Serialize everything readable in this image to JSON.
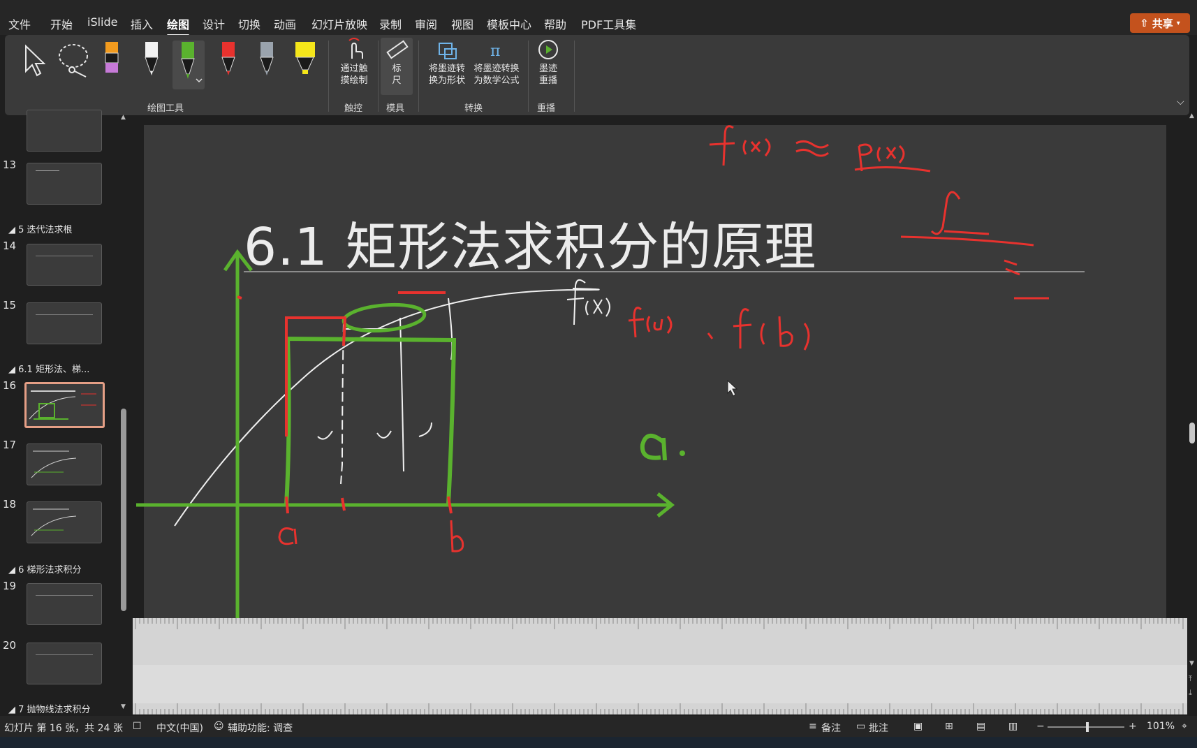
{
  "menu": {
    "items": [
      "文件",
      "开始",
      "iSlide",
      "插入",
      "绘图",
      "设计",
      "切换",
      "动画",
      "幻灯片放映",
      "录制",
      "审阅",
      "视图",
      "模板中心",
      "帮助",
      "PDF工具集"
    ],
    "active_index": 4,
    "share_label": "共享"
  },
  "ribbon": {
    "groups": {
      "draw_tools": "绘图工具",
      "touch": "触控",
      "stencils": "模具",
      "convert": "转换",
      "replay": "重播"
    },
    "buttons": {
      "touch_draw": [
        "通过触",
        "摸绘制"
      ],
      "ruler": [
        "标",
        "尺"
      ],
      "ink_to_shape": [
        "将墨迹转",
        "换为形状"
      ],
      "ink_to_math": [
        "将墨迹转换",
        "为数学公式"
      ],
      "ink_replay": [
        "墨迹",
        "重播"
      ]
    },
    "pen_colors": [
      "#f29b1e",
      "#f2f2f2",
      "#5ab22e",
      "#e8322e",
      "#9aa3ad",
      "#f5e61a"
    ]
  },
  "slide_panel": {
    "slides": [
      {
        "num": "13",
        "selected": false
      },
      {
        "num": "14",
        "selected": false
      },
      {
        "num": "15",
        "selected": false
      },
      {
        "num": "16",
        "selected": true
      },
      {
        "num": "17",
        "selected": false
      },
      {
        "num": "18",
        "selected": false
      },
      {
        "num": "19",
        "selected": false
      },
      {
        "num": "20",
        "selected": false
      }
    ],
    "sections": [
      "5 迭代法求根",
      "6.1 矩形法、梯...",
      "6 梯形法求积分",
      "7 抛物线法求积分"
    ]
  },
  "slide": {
    "title": "6.1 矩形法求积分的原理",
    "ink_colors": {
      "green": "#5ab22e",
      "red": "#e8322e",
      "white": "#f0f0f0"
    }
  },
  "status": {
    "slide_info": "幻灯片 第 16 张，共 24 张",
    "language": "中文(中国)",
    "accessibility": "辅助功能: 调查",
    "notes": "备注",
    "comments": "批注",
    "zoom": "101%"
  }
}
